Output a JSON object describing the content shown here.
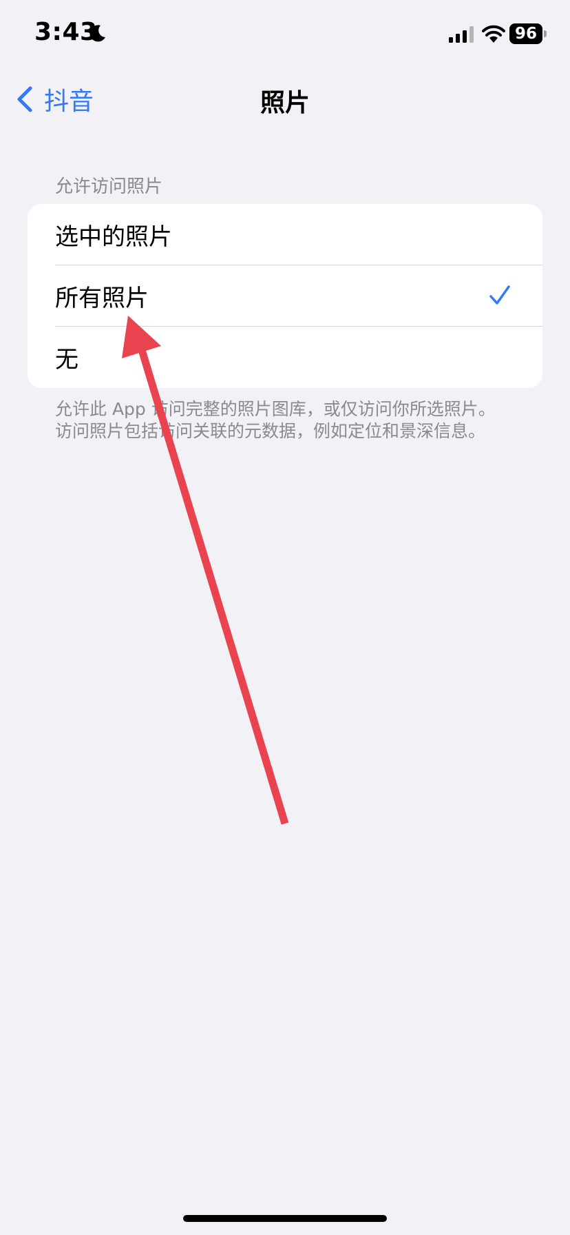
{
  "status_bar": {
    "time": "3:43",
    "battery": "96",
    "icons": [
      "moon-icon",
      "signal-icon",
      "wifi-icon",
      "battery-icon"
    ]
  },
  "nav": {
    "back_label": "抖音",
    "title": "照片"
  },
  "section": {
    "header": "允许访问照片",
    "options": [
      {
        "label": "选中的照片",
        "selected": false
      },
      {
        "label": "所有照片",
        "selected": true
      },
      {
        "label": "无",
        "selected": false
      }
    ],
    "footer_lines": [
      "允许此 App 访问完整的照片图库，或仅访问你所选照片。",
      "访问照片包括访问关联的元数据，例如定位和景深信息。"
    ]
  },
  "colors": {
    "accent": "#3478F6",
    "background": "#F2F1F6",
    "annotation_arrow": "#E8434F"
  }
}
